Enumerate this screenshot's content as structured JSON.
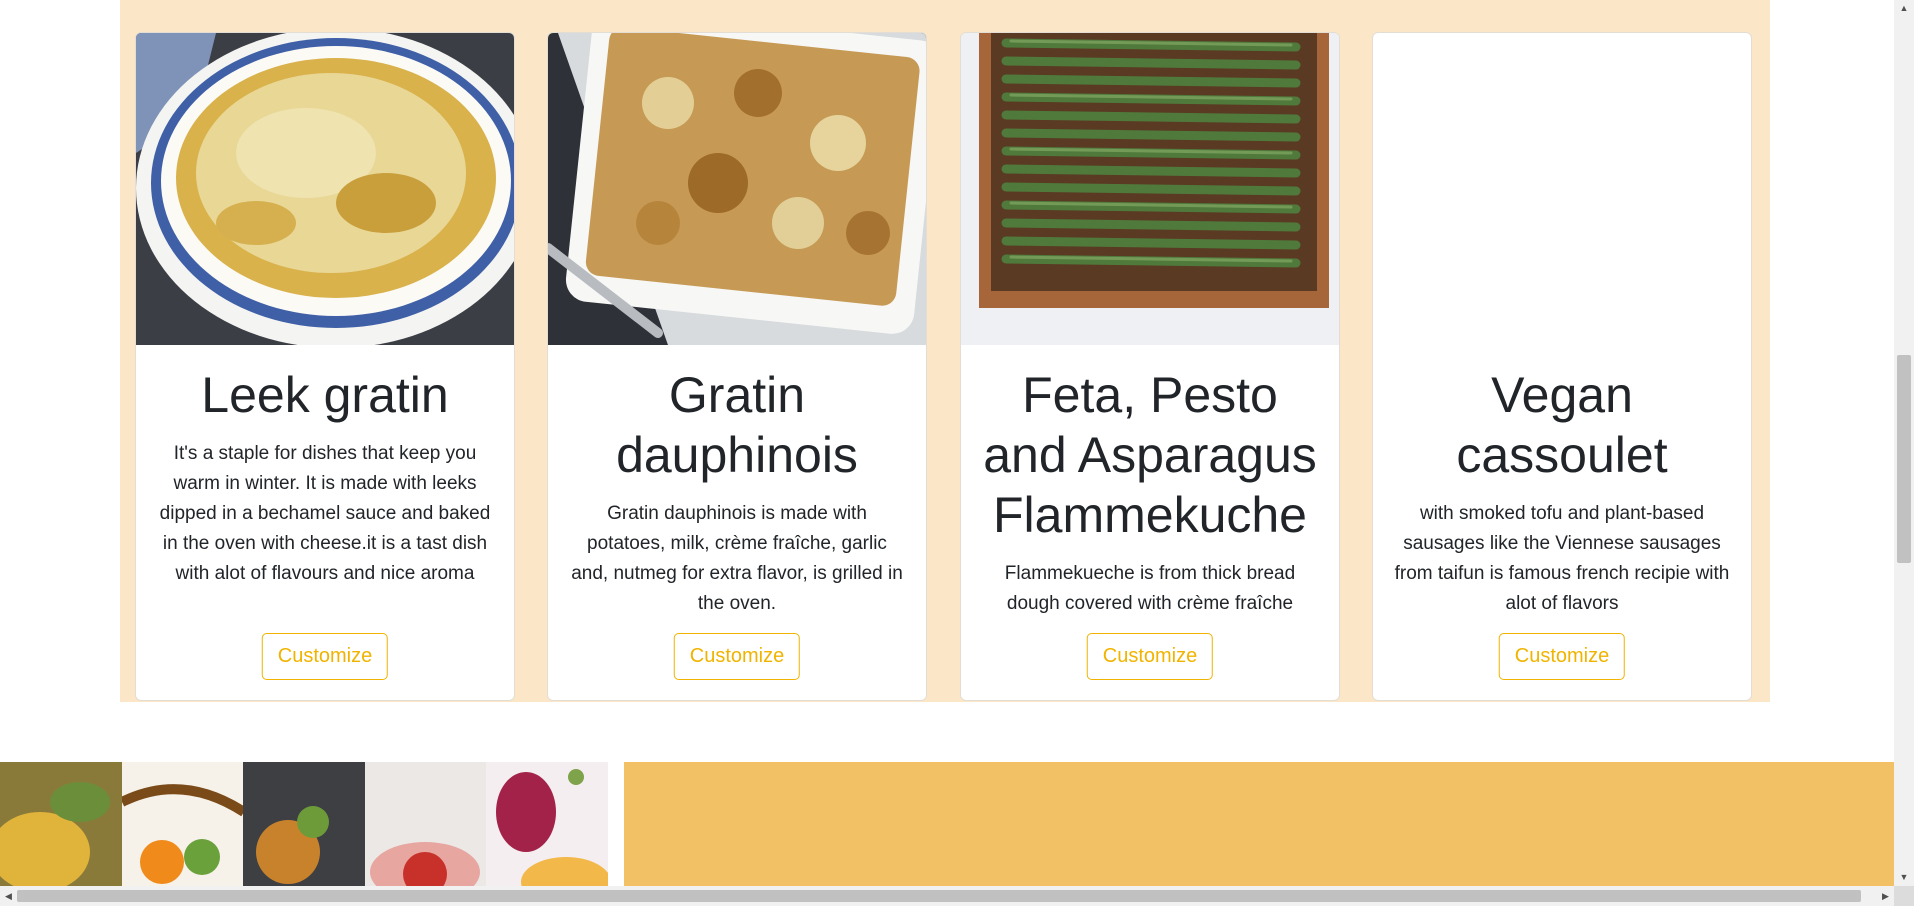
{
  "cards": [
    {
      "title": "Leek gratin",
      "description": "It's a staple for dishes that keep you warm in winter. It is made with leeks dipped in a bechamel sauce and baked in the oven with cheese.it is a tast dish with alot of flavours and nice aroma",
      "button_label": "Customize",
      "image": "leek-gratin-dish"
    },
    {
      "title": "Gratin dauphinois",
      "description": "Gratin dauphinois is made with potatoes, milk, crème fraîche, garlic and, nutmeg for extra flavor, is grilled in the oven.",
      "button_label": "Customize",
      "image": "gratin-dauphinois-dish"
    },
    {
      "title": "Feta, Pesto and Asparagus Flammekuche",
      "description": "Flammekueche is from thick bread dough covered with crème fraîche",
      "button_label": "Customize",
      "image": "asparagus-tart"
    },
    {
      "title": "Vegan cassoulet",
      "description": "with smoked tofu and plant-based sausages like the Viennese sausages from taifun is famous french recipie with alot of flavors",
      "button_label": "Customize",
      "image": "blank"
    }
  ],
  "colors": {
    "section_bg": "#fbe7c8",
    "accent": "#f0b400",
    "panel": "#f2c166"
  },
  "scrollbar": {
    "up_arrow": "▲",
    "down_arrow": "▼",
    "left_arrow": "◀",
    "right_arrow": "▶"
  }
}
